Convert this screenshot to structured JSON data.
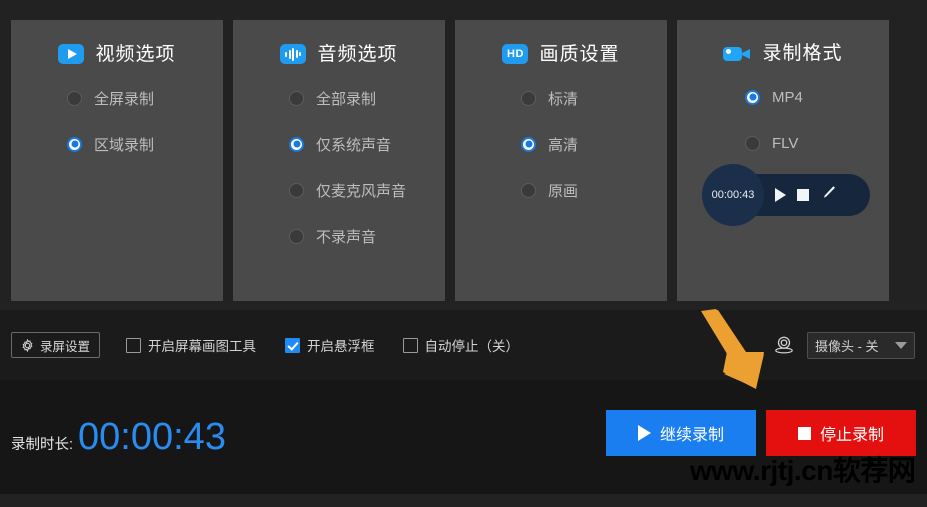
{
  "theme": {
    "background": "#222222",
    "panel_bg": "#4a4a4a",
    "accent_blue": "#1f8bf5",
    "timer_blue": "#2a8cf0",
    "stop_red": "#e41010",
    "arrow_orange": "#eca032"
  },
  "panels": [
    {
      "icon": "play-badge-icon",
      "title": "视频选项",
      "options": [
        {
          "label": "全屏录制",
          "selected": false
        },
        {
          "label": "区域录制",
          "selected": true
        }
      ]
    },
    {
      "icon": "audio-wave-badge-icon",
      "title": "音频选项",
      "options": [
        {
          "label": "全部录制",
          "selected": false
        },
        {
          "label": "仅系统声音",
          "selected": true
        },
        {
          "label": "仅麦克风声音",
          "selected": false
        },
        {
          "label": "不录声音",
          "selected": false
        }
      ]
    },
    {
      "icon": "hd-badge-icon",
      "title": "画质设置",
      "options": [
        {
          "label": "标清",
          "selected": false
        },
        {
          "label": "高清",
          "selected": true
        },
        {
          "label": "原画",
          "selected": false
        }
      ]
    },
    {
      "icon": "camcorder-badge-icon",
      "title": "录制格式",
      "options": [
        {
          "label": "MP4",
          "selected": true
        },
        {
          "label": "FLV",
          "selected": false
        }
      ]
    }
  ],
  "hd_badge_text": "HD",
  "float_widget": {
    "time": "00:00:43",
    "controls": [
      "play-icon",
      "stop-icon",
      "pencil-icon"
    ]
  },
  "toolbar": {
    "settings_button": "录屏设置",
    "settings_icon": "gear-icon",
    "checkboxes": [
      {
        "label": "开启屏幕画图工具",
        "checked": false
      },
      {
        "label": "开启悬浮框",
        "checked": true
      },
      {
        "label": "自动停止（关）",
        "checked": false
      }
    ],
    "webcam_icon": "webcam-icon",
    "camera_select": {
      "value": "摄像头 - 关",
      "caret": "chevron-down-icon"
    }
  },
  "bottom": {
    "duration_label": "录制时长:",
    "duration_value": "00:00:43",
    "resume_button": {
      "label": "继续录制",
      "icon": "play-icon"
    },
    "stop_button": {
      "label": "停止录制",
      "icon": "stop-icon"
    }
  },
  "watermark": "www.rjtj.cn软荐网"
}
